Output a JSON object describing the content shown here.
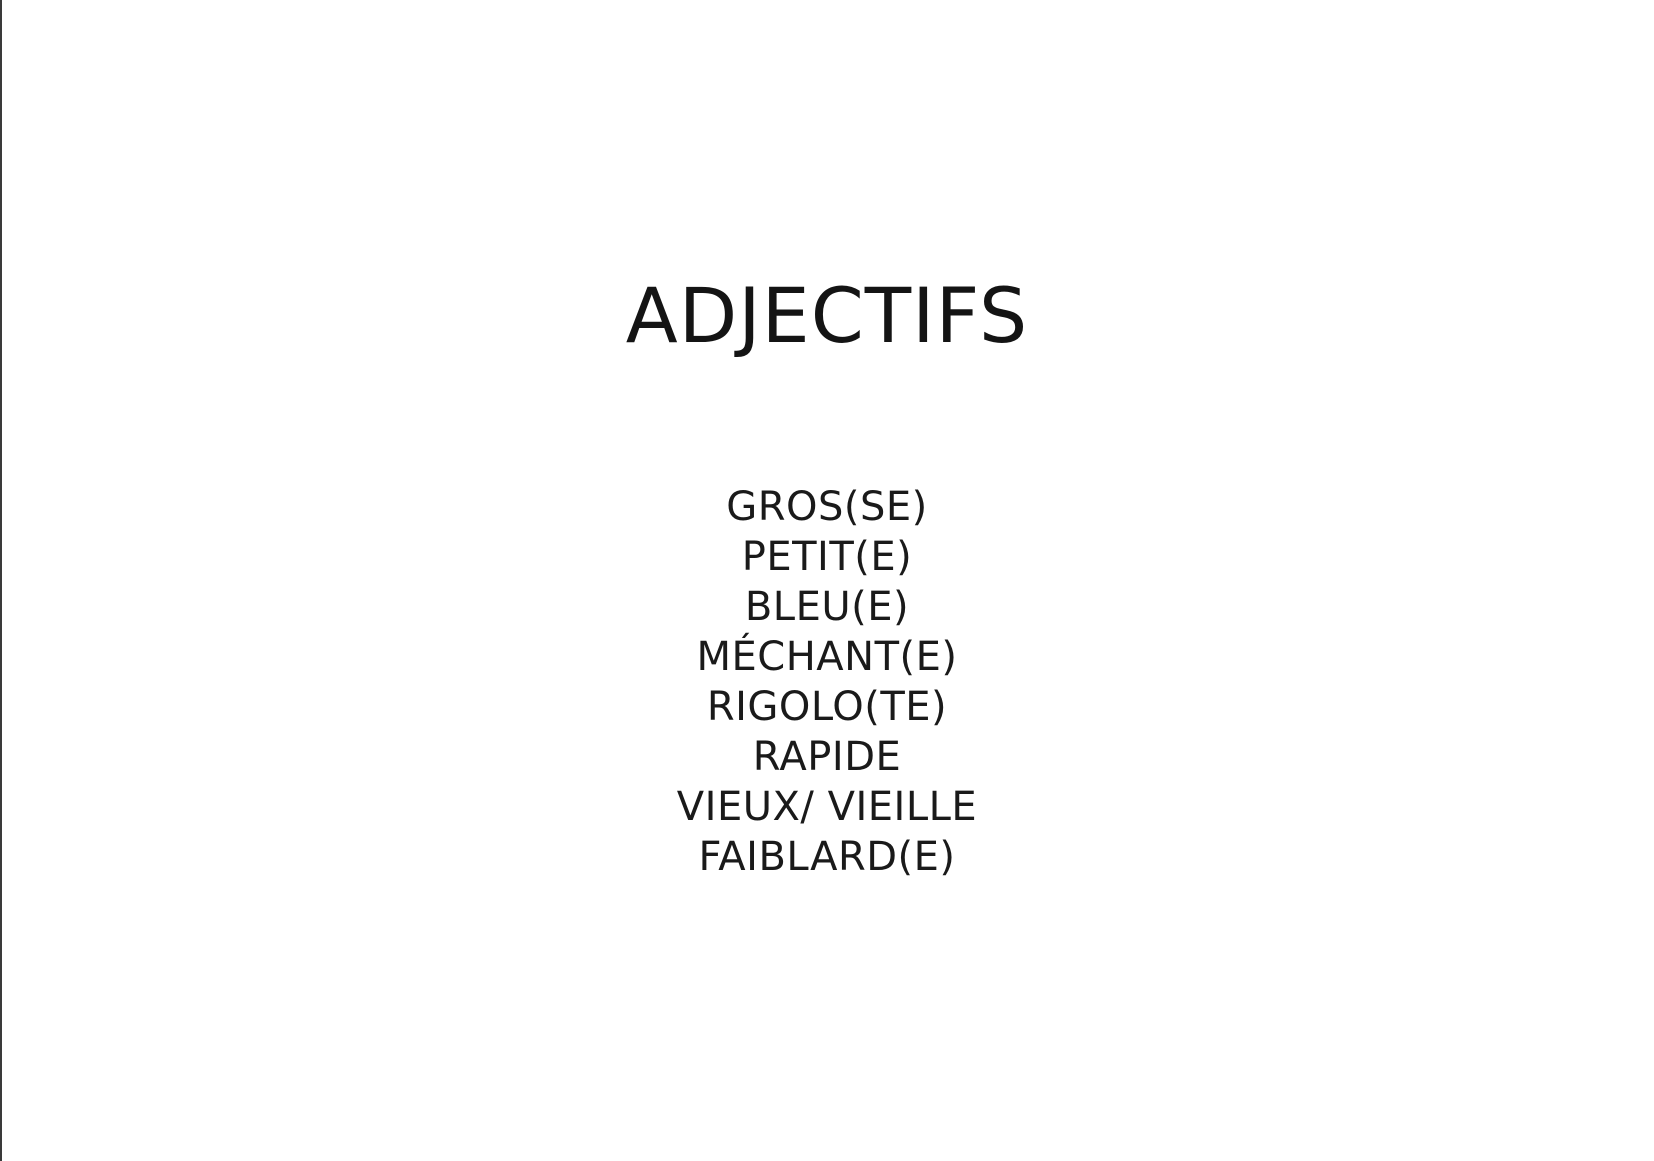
{
  "document": {
    "title": "ADJECTIFS",
    "words": [
      "GROS(SE)",
      "PETIT(E)",
      "BLEU(E)",
      "MÉCHANT(E)",
      "RIGOLO(TE)",
      "RAPIDE",
      "VIEUX/ VIEILLE",
      "FAIBLARD(E)"
    ]
  }
}
